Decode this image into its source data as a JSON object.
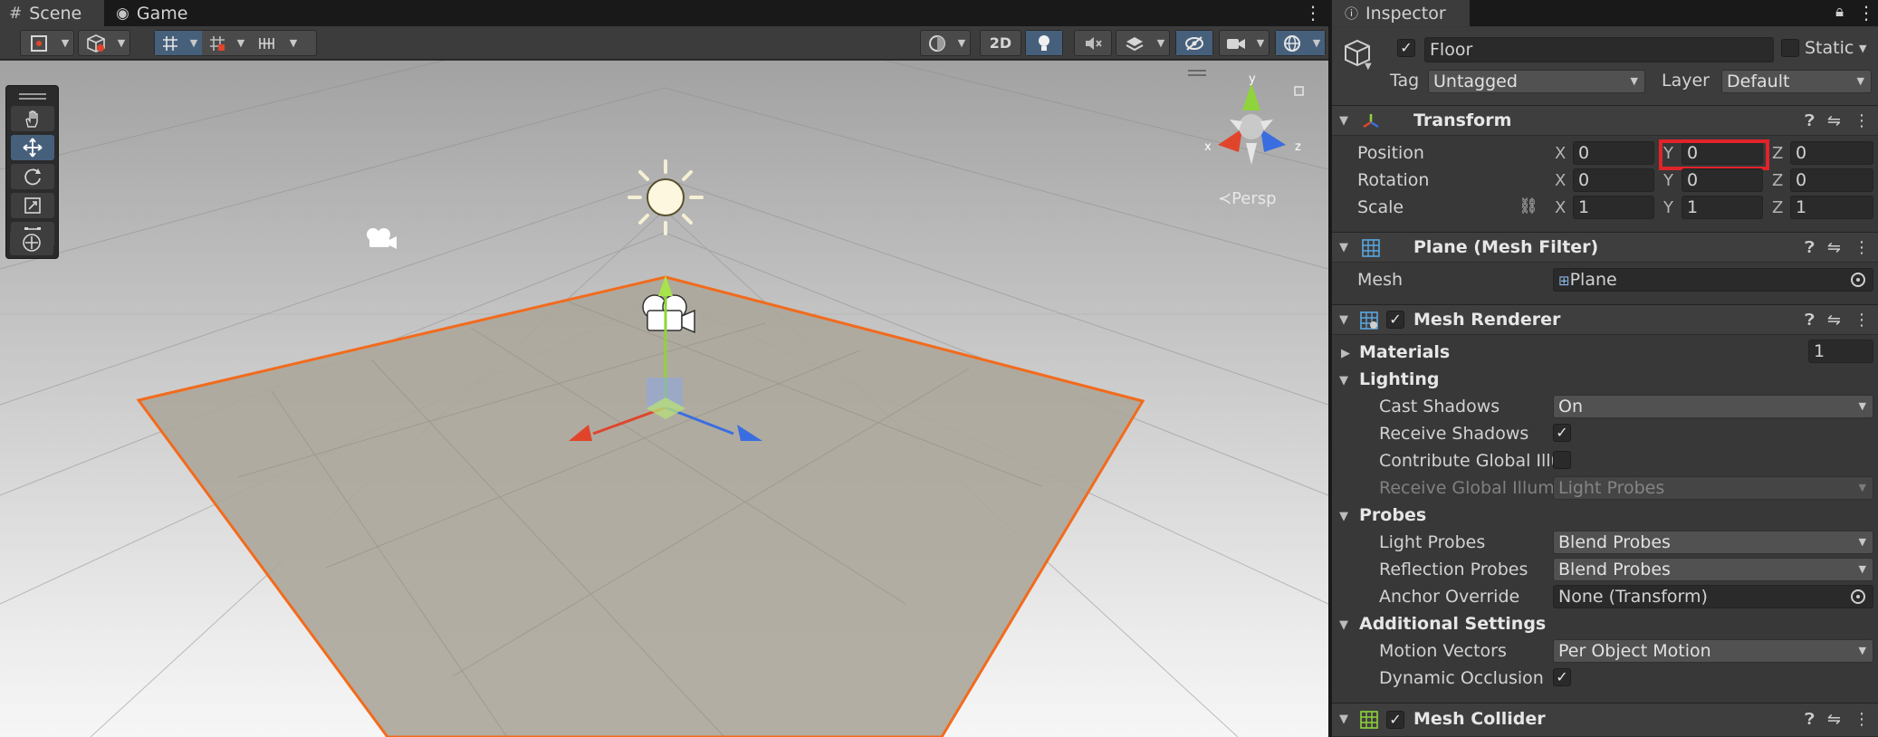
{
  "scene_window": {
    "tabs": [
      {
        "label": "Scene",
        "icon": "scene-grid-icon",
        "active": true
      },
      {
        "label": "Game",
        "icon": "game-controller-icon",
        "active": false
      }
    ],
    "toolbar": {
      "mode_2d": "2D",
      "persp_label": "Persp"
    },
    "gizmo_axes": {
      "x": "x",
      "y": "y",
      "z": "z"
    }
  },
  "inspector": {
    "tab_label": "Inspector",
    "object": {
      "name": "Floor",
      "static_label": "Static",
      "static_checked": false,
      "active_checked": true,
      "tag_label": "Tag",
      "tag_value": "Untagged",
      "layer_label": "Layer",
      "layer_value": "Default"
    },
    "transform": {
      "title": "Transform",
      "position_label": "Position",
      "rotation_label": "Rotation",
      "scale_label": "Scale",
      "axis_x": "X",
      "axis_y": "Y",
      "axis_z": "Z",
      "position": {
        "x": "0",
        "y": "0",
        "z": "0"
      },
      "rotation": {
        "x": "0",
        "y": "0",
        "z": "0"
      },
      "scale": {
        "x": "1",
        "y": "1",
        "z": "1"
      }
    },
    "mesh_filter": {
      "title": "Plane (Mesh Filter)",
      "mesh_label": "Mesh",
      "mesh_value": "Plane"
    },
    "mesh_renderer": {
      "title": "Mesh Renderer",
      "enabled": true,
      "materials_label": "Materials",
      "materials_count": "1",
      "lighting_label": "Lighting",
      "cast_shadows_label": "Cast Shadows",
      "cast_shadows_value": "On",
      "receive_shadows_label": "Receive Shadows",
      "receive_shadows_checked": true,
      "contribute_gi_label": "Contribute Global Illu",
      "contribute_gi_checked": false,
      "receive_gi_label": "Receive Global Illumi",
      "receive_gi_value": "Light Probes",
      "probes_label": "Probes",
      "light_probes_label": "Light Probes",
      "light_probes_value": "Blend Probes",
      "reflection_probes_label": "Reflection Probes",
      "reflection_probes_value": "Blend Probes",
      "anchor_override_label": "Anchor Override",
      "anchor_override_value": "None (Transform)",
      "additional_settings_label": "Additional Settings",
      "motion_vectors_label": "Motion Vectors",
      "motion_vectors_value": "Per Object Motion",
      "dynamic_occlusion_label": "Dynamic Occlusion",
      "dynamic_occlusion_checked": true
    },
    "mesh_collider": {
      "title": "Mesh Collider",
      "enabled": true
    }
  },
  "colors": {
    "selection_outline": "#f26b1d",
    "highlight_box": "#e1232a",
    "axis_x": "#e0452c",
    "axis_y": "#8fd43b",
    "axis_z": "#3a6ee0",
    "toggle_on": "#46607c"
  }
}
